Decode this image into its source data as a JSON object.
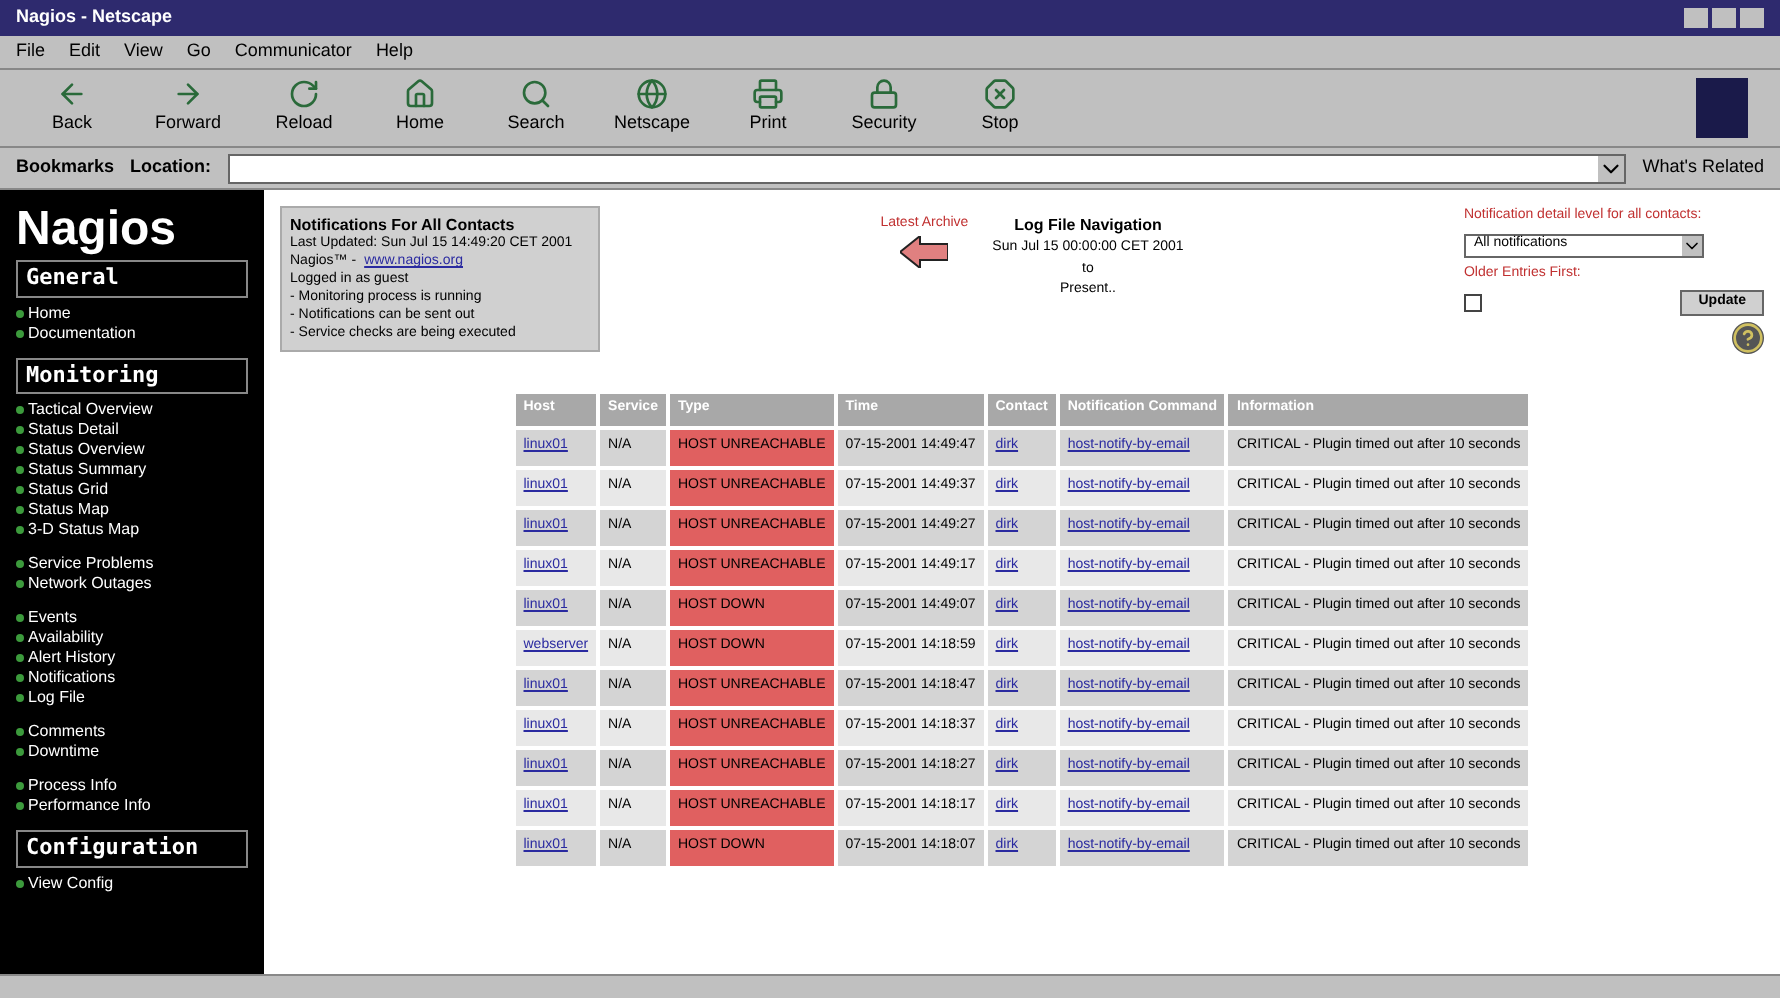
{
  "window": {
    "title": "Nagios - Netscape"
  },
  "menu": [
    "File",
    "Edit",
    "View",
    "Go",
    "Communicator",
    "Help"
  ],
  "toolbar": [
    {
      "label": "Back",
      "kind": "back"
    },
    {
      "label": "Forward",
      "kind": "forward"
    },
    {
      "label": "Reload",
      "kind": "reload"
    },
    {
      "label": "Home",
      "kind": "home"
    },
    {
      "label": "Search",
      "kind": "search"
    },
    {
      "label": "Netscape",
      "kind": "netscape"
    },
    {
      "label": "Print",
      "kind": "print"
    },
    {
      "label": "Security",
      "kind": "security"
    },
    {
      "label": "Stop",
      "kind": "stop"
    }
  ],
  "location_bar": {
    "bookmarks": "Bookmarks",
    "label": "Location:",
    "related": "What's Related"
  },
  "sidebar": {
    "logo": "Nagios",
    "sections": [
      {
        "title": "General",
        "groups": [
          [
            "Home",
            "Documentation"
          ]
        ]
      },
      {
        "title": "Monitoring",
        "groups": [
          [
            "Tactical Overview",
            "Status Detail",
            "Status Overview",
            "Status Summary",
            "Status Grid",
            "Status Map",
            "3-D Status Map"
          ],
          [
            "Service Problems",
            "Network Outages"
          ],
          [
            "Events",
            "Availability",
            "Alert History",
            "Notifications",
            "Log File"
          ],
          [
            "Comments",
            "Downtime"
          ],
          [
            "Process Info",
            "Performance Info"
          ]
        ]
      },
      {
        "title": "Configuration",
        "groups": [
          [
            "View Config"
          ]
        ]
      }
    ]
  },
  "info_box": {
    "title": "Notifications For All Contacts",
    "updated": "Last Updated: Sun Jul 15 14:49:20 CET 2001",
    "product": "Nagios™ -",
    "link": "www.nagios.org",
    "login": "Logged in as guest",
    "status": [
      "- Monitoring process is running",
      "- Notifications can be sent out",
      "- Service checks are being executed"
    ]
  },
  "navigation": {
    "archive_label": "Latest Archive",
    "title": "Log File Navigation",
    "from": "Sun Jul 15 00:00:00 CET 2001",
    "to": "to",
    "end": "Present.."
  },
  "filter": {
    "label": "Notification detail level for all contacts:",
    "select": "All notifications",
    "older_label": "Older Entries First:",
    "older_checked": false,
    "button": "Update"
  },
  "table": {
    "columns": [
      "Host",
      "Service",
      "Type",
      "Time",
      "Contact",
      "Notification Command",
      "Information"
    ],
    "rows": [
      [
        "linux01",
        "N/A",
        "HOST UNREACHABLE",
        "07-15-2001 14:49:47",
        "dirk",
        "host-notify-by-email",
        "CRITICAL - Plugin timed out after 10 seconds"
      ],
      [
        "linux01",
        "N/A",
        "HOST UNREACHABLE",
        "07-15-2001 14:49:37",
        "dirk",
        "host-notify-by-email",
        "CRITICAL - Plugin timed out after 10 seconds"
      ],
      [
        "linux01",
        "N/A",
        "HOST UNREACHABLE",
        "07-15-2001 14:49:27",
        "dirk",
        "host-notify-by-email",
        "CRITICAL - Plugin timed out after 10 seconds"
      ],
      [
        "linux01",
        "N/A",
        "HOST UNREACHABLE",
        "07-15-2001 14:49:17",
        "dirk",
        "host-notify-by-email",
        "CRITICAL - Plugin timed out after 10 seconds"
      ],
      [
        "linux01",
        "N/A",
        "HOST DOWN",
        "07-15-2001 14:49:07",
        "dirk",
        "host-notify-by-email",
        "CRITICAL - Plugin timed out after 10 seconds"
      ],
      [
        "webserver",
        "N/A",
        "HOST DOWN",
        "07-15-2001 14:18:59",
        "dirk",
        "host-notify-by-email",
        "CRITICAL - Plugin timed out after 10 seconds"
      ],
      [
        "linux01",
        "N/A",
        "HOST UNREACHABLE",
        "07-15-2001 14:18:47",
        "dirk",
        "host-notify-by-email",
        "CRITICAL - Plugin timed out after 10 seconds"
      ],
      [
        "linux01",
        "N/A",
        "HOST UNREACHABLE",
        "07-15-2001 14:18:37",
        "dirk",
        "host-notify-by-email",
        "CRITICAL - Plugin timed out after 10 seconds"
      ],
      [
        "linux01",
        "N/A",
        "HOST UNREACHABLE",
        "07-15-2001 14:18:27",
        "dirk",
        "host-notify-by-email",
        "CRITICAL - Plugin timed out after 10 seconds"
      ],
      [
        "linux01",
        "N/A",
        "HOST UNREACHABLE",
        "07-15-2001 14:18:17",
        "dirk",
        "host-notify-by-email",
        "CRITICAL - Plugin timed out after 10 seconds"
      ],
      [
        "linux01",
        "N/A",
        "HOST DOWN",
        "07-15-2001 14:18:07",
        "dirk",
        "host-notify-by-email",
        "CRITICAL - Plugin timed out after 10 seconds"
      ]
    ]
  }
}
